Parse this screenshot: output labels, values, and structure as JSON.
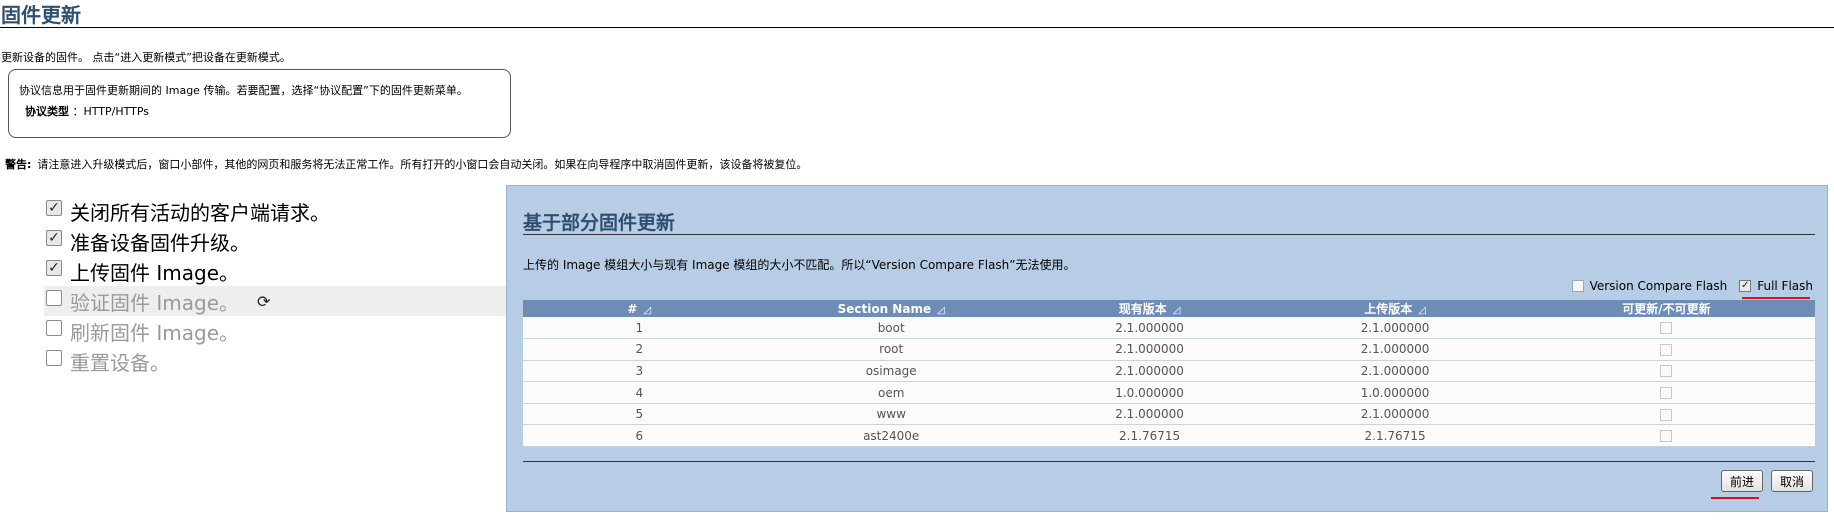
{
  "header": {
    "title": "固件更新"
  },
  "intro_text": "更新设备的固件。 点击“进入更新模式”把设备在更新模式。",
  "info": {
    "line1": "协议信息用于固件更新期间的 Image 传输。若要配置，选择“协议配置”下的固件更新菜单。",
    "protocol_label": "协议类型",
    "protocol_value": "：HTTP/HTTPs"
  },
  "warning": {
    "label": "警告:",
    "text": "请注意进入升级模式后，窗口小部件，其他的网页和服务将无法正常工作。所有打开的小窗口会自动关闭。如果在向导程序中取消固件更新，该设备将被复位。"
  },
  "steps": [
    {
      "label": "关闭所有活动的客户端请求。",
      "checked": true
    },
    {
      "label": "准备设备固件升级。",
      "checked": true
    },
    {
      "label": "上传固件 Image。",
      "checked": true
    },
    {
      "label": "验证固件 Image。",
      "checked": false,
      "current": true
    },
    {
      "label": "刷新固件 Image。",
      "checked": false
    },
    {
      "label": "重置设备。",
      "checked": false
    }
  ],
  "panel": {
    "title": "基于部分固件更新",
    "message": "上传的 Image 模组大小与现有 Image 模组的大小不匹配。所以“Version Compare Flash”无法使用。",
    "options": {
      "version_compare": "Version Compare Flash",
      "full_flash": "Full Flash"
    },
    "table": {
      "headers": [
        "#",
        "Section Name",
        "现有版本",
        "上传版本",
        "可更新/不可更新"
      ],
      "rows": [
        {
          "num": "1",
          "name": "boot",
          "current": "2.1.000000",
          "uploaded": "2.1.000000"
        },
        {
          "num": "2",
          "name": "root",
          "current": "2.1.000000",
          "uploaded": "2.1.000000"
        },
        {
          "num": "3",
          "name": "osimage",
          "current": "2.1.000000",
          "uploaded": "2.1.000000"
        },
        {
          "num": "4",
          "name": "oem",
          "current": "1.0.000000",
          "uploaded": "1.0.000000"
        },
        {
          "num": "5",
          "name": "www",
          "current": "2.1.000000",
          "uploaded": "2.1.000000"
        },
        {
          "num": "6",
          "name": "ast2400e",
          "current": "2.1.76715",
          "uploaded": "2.1.76715"
        }
      ]
    },
    "buttons": {
      "proceed": "前进",
      "cancel": "取消"
    }
  },
  "icons": {
    "step_check": "check-icon",
    "refresh": "refresh-icon",
    "sort": "sort-triangle-icon"
  },
  "colors": {
    "panel_bg": "#b7cde5",
    "table_header": "#6d8cb6",
    "title": "#2f4f6f",
    "highlight": "#d01818"
  }
}
